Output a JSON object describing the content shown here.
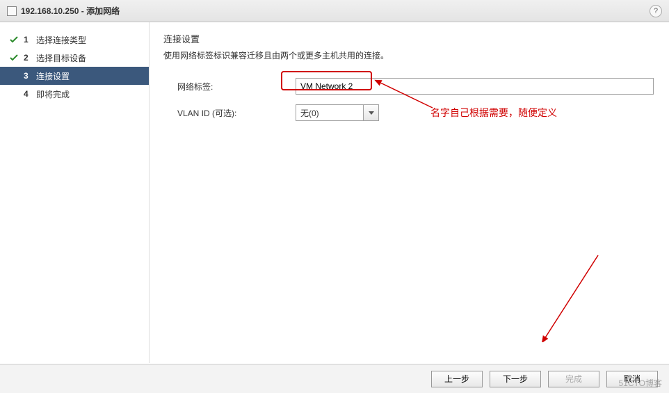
{
  "titlebar": {
    "title": "192.168.10.250 - 添加网络",
    "help_tooltip": "?"
  },
  "wizard": {
    "steps": [
      {
        "num": "1",
        "label": "选择连接类型",
        "state": "done"
      },
      {
        "num": "2",
        "label": "选择目标设备",
        "state": "done"
      },
      {
        "num": "3",
        "label": "连接设置",
        "state": "current"
      },
      {
        "num": "4",
        "label": "即将完成",
        "state": "pending"
      }
    ]
  },
  "content": {
    "section_title": "连接设置",
    "section_desc": "使用网络标签标识兼容迁移且由两个或更多主机共用的连接。",
    "network_label": {
      "label": "网络标签:",
      "value": "VM Network 2"
    },
    "vlan": {
      "label": "VLAN ID (可选):",
      "selected": "无(0)"
    }
  },
  "annotation": {
    "text": "名字自己根据需要，随便定义"
  },
  "footer": {
    "back": "上一步",
    "next": "下一步",
    "finish": "完成",
    "cancel": "取消"
  },
  "watermark": "51CTO博客"
}
